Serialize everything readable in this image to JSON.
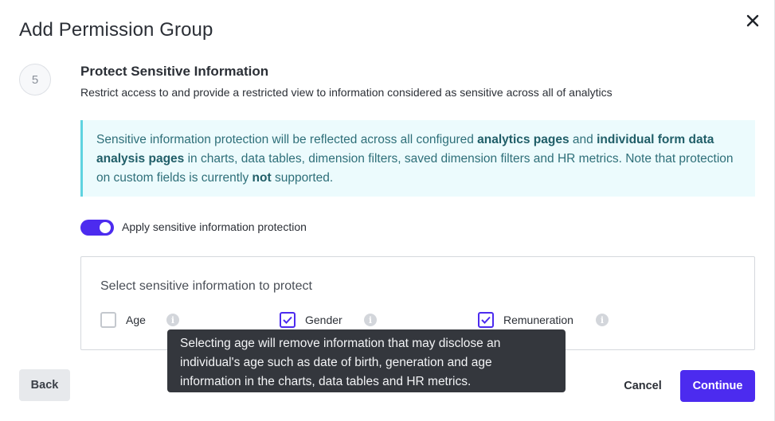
{
  "dialog": {
    "title": "Add Permission Group",
    "close_icon": "close-icon"
  },
  "step": {
    "number": "5",
    "title": "Protect Sensitive Information",
    "description": "Restrict access to and provide a restricted view to information considered as sensitive across all of analytics"
  },
  "info_box": {
    "text_1": "Sensitive information protection will be reflected across all configured ",
    "bold_1": "analytics pages",
    "text_2": " and ",
    "bold_2": "individual form data analysis pages",
    "text_3": " in charts, data tables, dimension filters, saved dimension filters and HR metrics. Note that protection on custom fields is currently ",
    "bold_3": "not",
    "text_4": " supported."
  },
  "toggle": {
    "label": "Apply sensitive information protection",
    "on": true
  },
  "options": {
    "title": "Select sensitive information to protect",
    "items": [
      {
        "label": "Age",
        "checked": false,
        "info_icon": "info-icon"
      },
      {
        "label": "Gender",
        "checked": true,
        "info_icon": "info-icon"
      },
      {
        "label": "Remuneration",
        "checked": true,
        "info_icon": "info-icon"
      }
    ]
  },
  "tooltip": {
    "text": "Selecting age will remove information that may disclose an individual's age such as date of birth, generation and age information in the charts, data tables and HR metrics."
  },
  "footer": {
    "back_label": "Back",
    "cancel_label": "Cancel",
    "continue_label": "Continue"
  },
  "colors": {
    "accent": "#4c2bef",
    "info_bg": "#ecfbfd",
    "info_border": "#5fd3e0",
    "tooltip_bg": "#34373d"
  }
}
